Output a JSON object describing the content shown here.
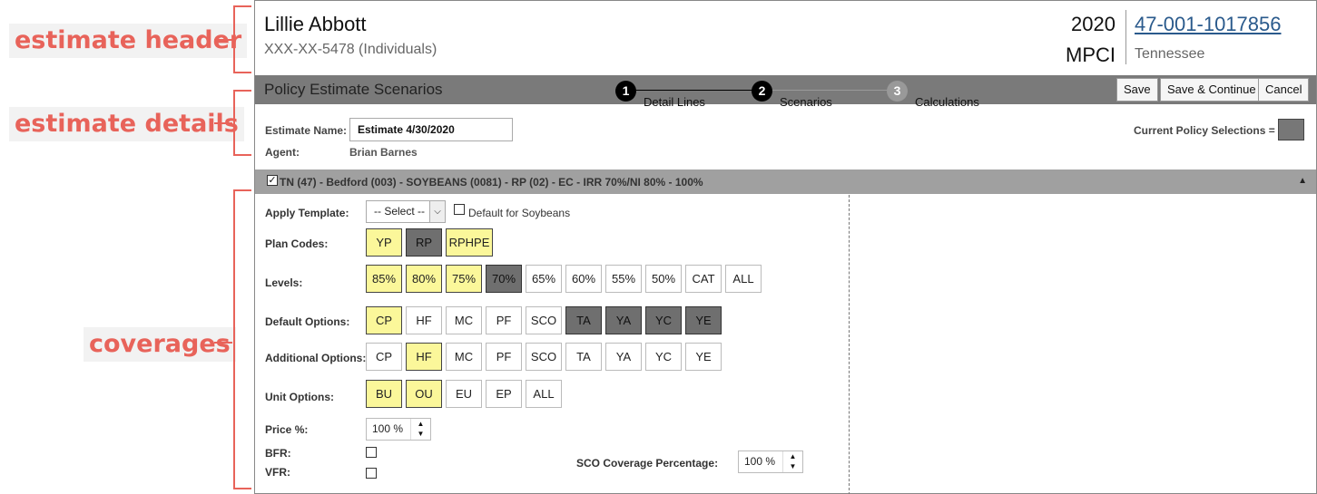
{
  "annotations": {
    "estimate_header": "estimate header",
    "estimate_details": "estimate details",
    "coverages": "coverages"
  },
  "header": {
    "name": "Lillie Abbott",
    "ssn": "XXX-XX-5478 (Individuals)",
    "year": "2020",
    "type": "MPCI",
    "policy_number": "47-001-1017856",
    "state": "Tennessee"
  },
  "titlebar": {
    "title": "Policy Estimate Scenarios",
    "steps": [
      {
        "num": "1",
        "label": "Detail Lines"
      },
      {
        "num": "2",
        "label": "Scenarios"
      },
      {
        "num": "3",
        "label": "Calculations"
      }
    ],
    "buttons": {
      "save": "Save",
      "save_continue": "Save & Continue",
      "cancel": "Cancel"
    }
  },
  "details": {
    "estimate_name_label": "Estimate Name:",
    "estimate_name_value": "Estimate 4/30/2020",
    "agent_label": "Agent:",
    "agent_value": "Brian Barnes",
    "current_selections_label": "Current Policy Selections =",
    "current_selections_color": "#777777"
  },
  "section": {
    "checked": true,
    "title": "TN (47) - Bedford (003) - SOYBEANS (0081) - RP (02) - EC - IRR 70%/NI 80% - 100%"
  },
  "coverages": {
    "apply_template_label": "Apply Template:",
    "template_select": "-- Select --",
    "default_for_label": "Default for Soybeans",
    "plan_codes_label": "Plan Codes:",
    "plan_codes": [
      {
        "label": "YP",
        "state": "yellow"
      },
      {
        "label": "RP",
        "state": "dark"
      },
      {
        "label": "RPHPE",
        "state": "yellow"
      }
    ],
    "levels_label": "Levels:",
    "levels": [
      {
        "label": "85%",
        "state": "yellow"
      },
      {
        "label": "80%",
        "state": "yellow"
      },
      {
        "label": "75%",
        "state": "yellow"
      },
      {
        "label": "70%",
        "state": "dark"
      },
      {
        "label": "65%",
        "state": "none"
      },
      {
        "label": "60%",
        "state": "none"
      },
      {
        "label": "55%",
        "state": "none"
      },
      {
        "label": "50%",
        "state": "none"
      },
      {
        "label": "CAT",
        "state": "none"
      },
      {
        "label": "ALL",
        "state": "none"
      }
    ],
    "default_options_label": "Default Options:",
    "default_options": [
      {
        "label": "CP",
        "state": "yellow"
      },
      {
        "label": "HF",
        "state": "none"
      },
      {
        "label": "MC",
        "state": "none"
      },
      {
        "label": "PF",
        "state": "none"
      },
      {
        "label": "SCO",
        "state": "none"
      },
      {
        "label": "TA",
        "state": "dark"
      },
      {
        "label": "YA",
        "state": "dark"
      },
      {
        "label": "YC",
        "state": "dark"
      },
      {
        "label": "YE",
        "state": "dark"
      }
    ],
    "additional_options_label": "Additional Options:",
    "additional_options": [
      {
        "label": "CP",
        "state": "none"
      },
      {
        "label": "HF",
        "state": "yellow"
      },
      {
        "label": "MC",
        "state": "none"
      },
      {
        "label": "PF",
        "state": "none"
      },
      {
        "label": "SCO",
        "state": "none"
      },
      {
        "label": "TA",
        "state": "none"
      },
      {
        "label": "YA",
        "state": "none"
      },
      {
        "label": "YC",
        "state": "none"
      },
      {
        "label": "YE",
        "state": "none"
      }
    ],
    "unit_options_label": "Unit Options:",
    "unit_options": [
      {
        "label": "BU",
        "state": "yellow"
      },
      {
        "label": "OU",
        "state": "yellow"
      },
      {
        "label": "EU",
        "state": "none"
      },
      {
        "label": "EP",
        "state": "none"
      },
      {
        "label": "ALL",
        "state": "none"
      }
    ],
    "price_label": "Price %:",
    "price_value": "100 %",
    "bfr_label": "BFR:",
    "vfr_label": "VFR:",
    "sco_label": "SCO Coverage Percentage:",
    "sco_value": "100 %"
  },
  "colors": {
    "accent_annotation": "#e8635a",
    "selected_yellow": "#fbf79a",
    "current_dark": "#6f6f6f",
    "link_blue": "#2a5a8c"
  }
}
